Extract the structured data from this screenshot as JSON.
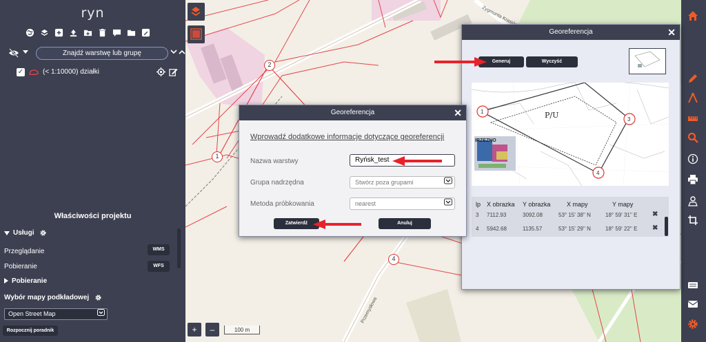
{
  "left_panel": {
    "project_title": "ryn",
    "toolbar_icons": [
      "globe-icon",
      "layers-icon",
      "add-layer-icon",
      "upload-icon",
      "add-folder-icon",
      "delete-icon",
      "comment-icon",
      "folder-icon",
      "edit-icon"
    ],
    "layer_search": "Znajdź warstwę lub grupę",
    "layer": {
      "label": "(< 1:10000) działki",
      "checked": true
    },
    "project_props_title": "Właściwości projektu",
    "services": {
      "header": "Usługi",
      "rows": [
        {
          "label": "Przeglądanie",
          "button": "WMS"
        },
        {
          "label": "Pobieranie",
          "button": "WFS"
        }
      ]
    },
    "download_header": "Pobieranie",
    "basemap": {
      "header": "Wybór mapy podkładowej",
      "selected": "Open Street Map"
    },
    "tutorial_button": "Rozpocznij poradnik"
  },
  "map": {
    "zoom_in": "+",
    "zoom_out": "–",
    "scale": "100 m",
    "point_labels": [
      "1",
      "2",
      "4"
    ],
    "street_labels": [
      "Przemysłowa",
      "Zygmunta Krasińskiego"
    ]
  },
  "georef_dialog": {
    "title": "Georeferencja",
    "close": "✕",
    "generate_button": "Generuj",
    "clear_button": "Wyczyść",
    "image_labels": {
      "p1": "1",
      "p3": "3",
      "p4": "4",
      "zone": "P/U",
      "street": "IRZEZNO"
    },
    "table": {
      "headers": [
        "lp",
        "X obrazka",
        "Y obrazka",
        "X mapy",
        "Y mapy"
      ],
      "rows": [
        [
          "3",
          "7112.93",
          "3092.08",
          "53° 15' 38'' N",
          "18° 59' 31'' E"
        ],
        [
          "4",
          "5942.68",
          "1135.57",
          "53° 15' 29'' N",
          "18° 59' 22'' E"
        ]
      ]
    }
  },
  "meta_dialog": {
    "title": "Georeferencja",
    "close": "✕",
    "heading": "Wprowadź dodatkowe informacje dotyczące georeferencji",
    "fields": {
      "name_label": "Nazwa warstwy",
      "name_value": "Ryńsk_test",
      "group_label": "Grupa nadrzędna",
      "group_value": "Stwórz poza grupami",
      "method_label": "Metoda próbkowania",
      "method_value": "nearest"
    },
    "confirm_button": "Zatwierdź",
    "cancel_button": "Anuluj"
  },
  "right_toolbar": {
    "icons": [
      "home-icon",
      "pencil-icon",
      "compass-icon",
      "ruler-icon",
      "search-icon",
      "info-icon",
      "print-icon",
      "map-person-icon",
      "crop-icon",
      "keyboard-icon",
      "mail-icon",
      "settings-icon"
    ]
  },
  "colors": {
    "panel": "#3c4050",
    "accent_orange": "#f05a28",
    "map_line_red": "#e8434b",
    "arrow_red": "#e8222a"
  }
}
